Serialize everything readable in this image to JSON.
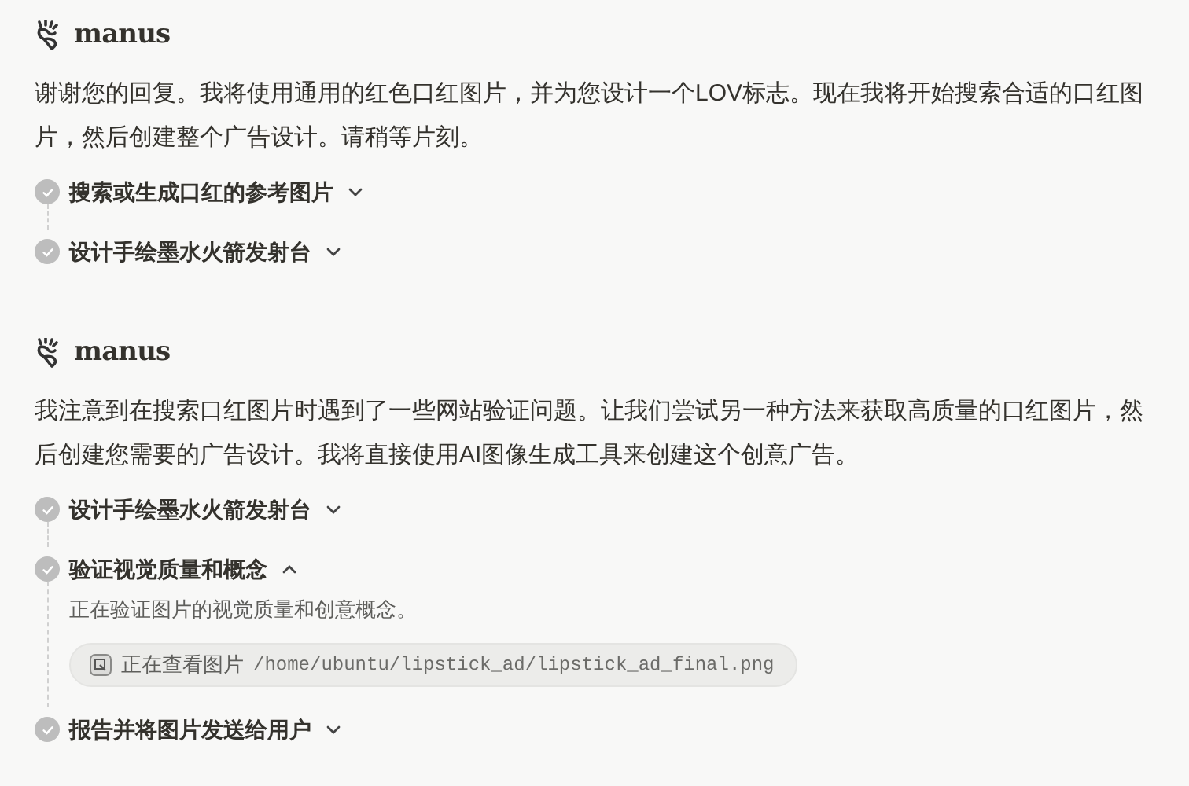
{
  "messages": [
    {
      "sender": "manus",
      "text": "谢谢您的回复。我将使用通用的红色口红图片，并为您设计一个LOV标志。现在我将开始搜索合适的口红图片，然后创建整个广告设计。请稍等片刻。",
      "steps": [
        {
          "title": "搜索或生成口红的参考图片",
          "done": true,
          "expanded": false
        },
        {
          "title": "设计手绘墨水火箭发射台",
          "done": true,
          "expanded": false
        }
      ]
    },
    {
      "sender": "manus",
      "text": "我注意到在搜索口红图片时遇到了一些网站验证问题。让我们尝试另一种方法来获取高质量的口红图片，然后创建您需要的广告设计。我将直接使用AI图像生成工具来创建这个创意广告。",
      "steps": [
        {
          "title": "设计手绘墨水火箭发射台",
          "done": true,
          "expanded": false
        },
        {
          "title": "验证视觉质量和概念",
          "done": true,
          "expanded": true,
          "detail": "正在验证图片的视觉质量和创意概念。",
          "tool": {
            "action": "正在查看图片",
            "path": "/home/ubuntu/lipstick_ad/lipstick_ad_final.png"
          }
        },
        {
          "title": "报告并将图片发送给用户",
          "done": true,
          "expanded": false
        }
      ]
    }
  ]
}
